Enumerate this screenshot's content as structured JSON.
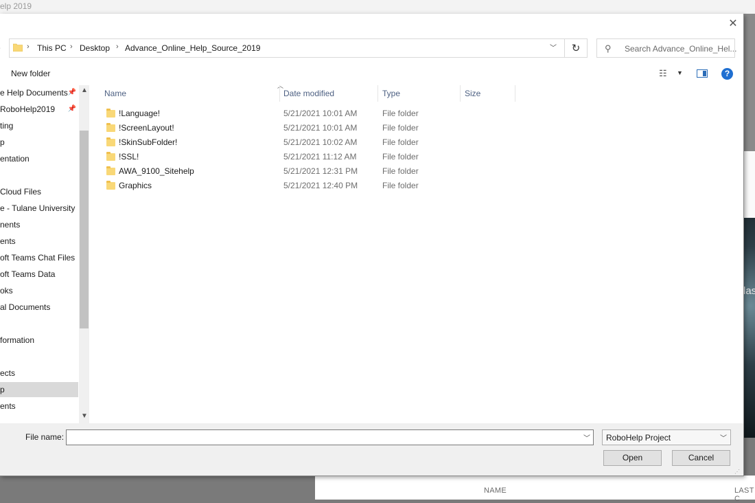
{
  "background": {
    "title": "elp 2019",
    "right_text": "las",
    "table_header_name": "NAME",
    "table_header_last": "LAST C"
  },
  "dialog": {
    "breadcrumb": [
      "This PC",
      "Desktop",
      "Advance_Online_Help_Source_2019"
    ],
    "search_placeholder": "Search Advance_Online_Hel...",
    "toolbar": {
      "new_folder": "New folder"
    },
    "nav_items": [
      {
        "label": "e Help Documents",
        "pinned": true
      },
      {
        "label": "RoboHelp2019",
        "pinned": true
      },
      {
        "label": "ting",
        "pinned": false
      },
      {
        "label": "p",
        "pinned": false
      },
      {
        "label": "entation",
        "pinned": false
      },
      {
        "label": "",
        "pinned": false
      },
      {
        "label": "Cloud Files",
        "pinned": false
      },
      {
        "label": "e - Tulane University",
        "pinned": false
      },
      {
        "label": "nents",
        "pinned": false
      },
      {
        "label": "ents",
        "pinned": false
      },
      {
        "label": "oft Teams Chat Files",
        "pinned": false
      },
      {
        "label": "oft Teams Data",
        "pinned": false
      },
      {
        "label": "oks",
        "pinned": false
      },
      {
        "label": "al Documents",
        "pinned": false
      },
      {
        "label": "",
        "pinned": false
      },
      {
        "label": "formation",
        "pinned": false
      },
      {
        "label": "",
        "pinned": false
      },
      {
        "label": "ects",
        "pinned": false
      },
      {
        "label": "p",
        "pinned": false,
        "selected": true
      },
      {
        "label": "ents",
        "pinned": false
      }
    ],
    "columns": {
      "name": "Name",
      "date": "Date modified",
      "type": "Type",
      "size": "Size"
    },
    "files": [
      {
        "name": "!Language!",
        "date": "5/21/2021 10:01 AM",
        "type": "File folder"
      },
      {
        "name": "!ScreenLayout!",
        "date": "5/21/2021 10:01 AM",
        "type": "File folder"
      },
      {
        "name": "!SkinSubFolder!",
        "date": "5/21/2021 10:02 AM",
        "type": "File folder"
      },
      {
        "name": "!SSL!",
        "date": "5/21/2021 11:12 AM",
        "type": "File folder"
      },
      {
        "name": "AWA_9100_Sitehelp",
        "date": "5/21/2021 12:31 PM",
        "type": "File folder"
      },
      {
        "name": "Graphics",
        "date": "5/21/2021 12:40 PM",
        "type": "File folder"
      }
    ],
    "file_name_label": "File name:",
    "file_name_value": "",
    "file_type": "RoboHelp Project",
    "open_label": "Open",
    "cancel_label": "Cancel"
  },
  "icons": {
    "close": "close-icon",
    "folder": "folder-icon",
    "refresh": "refresh-icon",
    "search": "search-icon",
    "help": "help-icon",
    "pin": "pin-icon"
  },
  "colors": {
    "accent": "#1f6fd1",
    "column_header": "#4d6082",
    "folder": "#f9d877",
    "selection": "#d9d9d9"
  }
}
